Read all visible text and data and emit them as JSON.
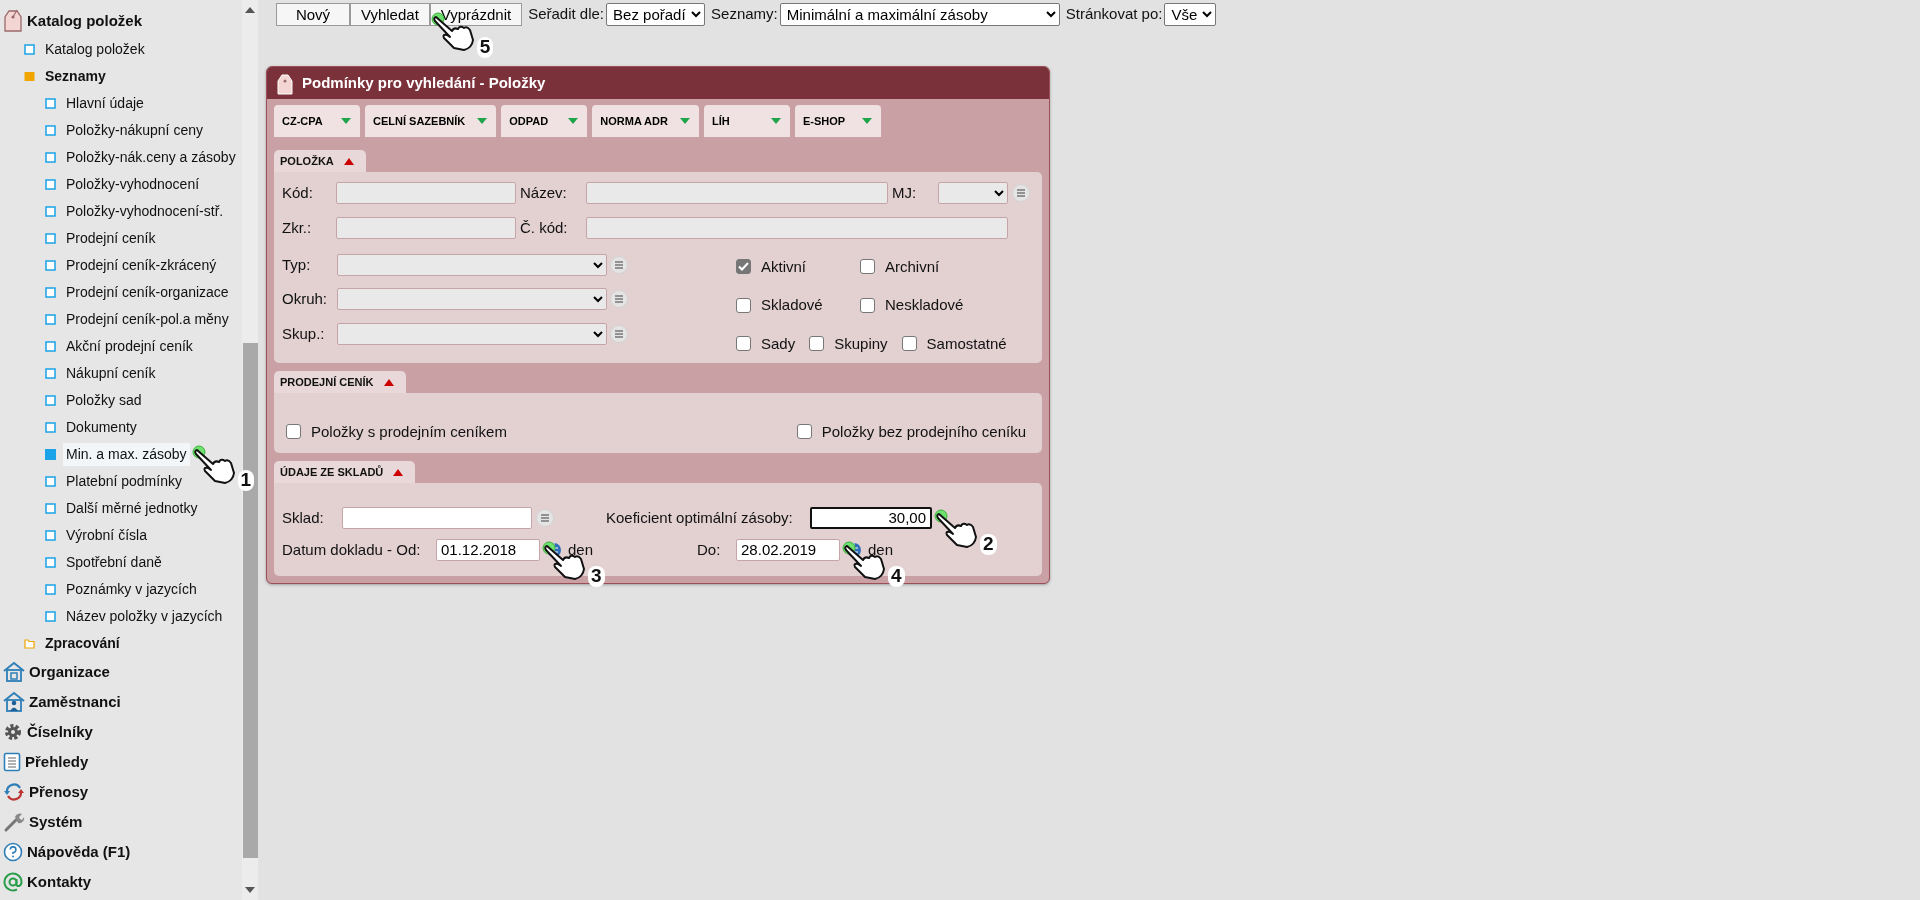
{
  "sidebar": {
    "items": [
      {
        "label": "Katalog položek",
        "kind": "catalog",
        "children": [
          {
            "label": "Katalog položek",
            "kind": "leaf",
            "selected": false
          },
          {
            "label": "Seznamy",
            "kind": "folder",
            "expanded": true,
            "children": [
              {
                "label": "Hlavní údaje",
                "kind": "leaf",
                "selected": false
              },
              {
                "label": "Položky-nákupní ceny",
                "kind": "leaf",
                "selected": false
              },
              {
                "label": "Položky-nák.ceny a zásoby",
                "kind": "leaf",
                "selected": false
              },
              {
                "label": "Položky-vyhodnocení",
                "kind": "leaf",
                "selected": false
              },
              {
                "label": "Položky-vyhodnocení-stř.",
                "kind": "leaf",
                "selected": false
              },
              {
                "label": "Prodejní ceník",
                "kind": "leaf",
                "selected": false
              },
              {
                "label": "Prodejní ceník-zkrácený",
                "kind": "leaf",
                "selected": false
              },
              {
                "label": "Prodejní ceník-organizace",
                "kind": "leaf",
                "selected": false
              },
              {
                "label": "Prodejní ceník-pol.a měny",
                "kind": "leaf",
                "selected": false
              },
              {
                "label": "Akční prodejní ceník",
                "kind": "leaf",
                "selected": false
              },
              {
                "label": "Nákupní ceník",
                "kind": "leaf",
                "selected": false
              },
              {
                "label": "Položky sad",
                "kind": "leaf",
                "selected": false
              },
              {
                "label": "Dokumenty",
                "kind": "leaf",
                "selected": false
              },
              {
                "label": "Min. a max. zásoby",
                "kind": "leaf",
                "selected": true,
                "callout": "1"
              },
              {
                "label": "Platební podmínky",
                "kind": "leaf",
                "selected": false
              },
              {
                "label": "Další měrné jednotky",
                "kind": "leaf",
                "selected": false
              },
              {
                "label": "Výrobní čísla",
                "kind": "leaf",
                "selected": false
              },
              {
                "label": "Spotřební daně",
                "kind": "leaf",
                "selected": false
              },
              {
                "label": "Poznámky v jazycích",
                "kind": "leaf",
                "selected": false
              },
              {
                "label": "Název položky v jazycích",
                "kind": "leaf",
                "selected": false
              }
            ]
          },
          {
            "label": "Zpracování",
            "kind": "folder",
            "expanded": false
          }
        ]
      },
      {
        "label": "Organizace",
        "kind": "organization"
      },
      {
        "label": "Zaměstnanci",
        "kind": "employees"
      },
      {
        "label": "Číselníky",
        "kind": "gear"
      },
      {
        "label": "Přehledy",
        "kind": "list"
      },
      {
        "label": "Přenosy",
        "kind": "transfer"
      },
      {
        "label": "Systém",
        "kind": "wrench"
      },
      {
        "label": "Nápověda (F1)",
        "kind": "help"
      },
      {
        "label": "Kontakty",
        "kind": "contacts"
      }
    ]
  },
  "toolbar": {
    "buttons": [
      {
        "label": "Nový"
      },
      {
        "label": "Vyhledat",
        "callout": "5"
      },
      {
        "label": "Vyprázdnit"
      }
    ],
    "selects": [
      {
        "label": "Seřadit dle:",
        "value": "Bez pořadí"
      },
      {
        "label": "Seznamy:",
        "value": "Minimální a maximální zásoby"
      },
      {
        "label": "Stránkovat po:",
        "value": "Vše"
      }
    ]
  },
  "dialog": {
    "title": "Podmínky pro vyhledání - Položky",
    "tabs": [
      {
        "label": "CZ-CPA"
      },
      {
        "label": "CELNÍ SAZEBNÍK"
      },
      {
        "label": "ODPAD"
      },
      {
        "label": "NORMA ADR"
      },
      {
        "label": "LÍH"
      },
      {
        "label": "E-SHOP"
      }
    ],
    "sections": [
      {
        "kind": "item",
        "title": "POLOŽKA",
        "expanded": true,
        "text_rows": [
          [
            {
              "label": "Kód:",
              "kind": "text"
            },
            {
              "label": "Název:",
              "kind": "text"
            },
            {
              "label": "MJ:",
              "kind": "select",
              "list_button": true
            }
          ],
          [
            {
              "label": "Zkr.:",
              "kind": "text"
            },
            {
              "label": "Č. kód:",
              "kind": "text"
            }
          ]
        ],
        "select_rows": [
          {
            "label": "Typ:",
            "list_button": true
          },
          {
            "label": "Okruh:",
            "list_button": true
          },
          {
            "label": "Skup.:",
            "list_button": true
          }
        ],
        "checkbox_rows": [
          [
            {
              "label": "Aktivní",
              "checked": true
            },
            {
              "label": "Archivní",
              "checked": false
            }
          ],
          [
            {
              "label": "Skladové",
              "checked": false
            },
            {
              "label": "Neskladové",
              "checked": false
            }
          ],
          [
            {
              "label": "Sady",
              "checked": false
            },
            {
              "label": "Skupiny",
              "checked": false
            },
            {
              "label": "Samostatné",
              "checked": false
            }
          ]
        ]
      },
      {
        "kind": "price",
        "title": "PRODEJNÍ CENÍK",
        "expanded": true,
        "checkboxes": [
          {
            "label": "Položky s prodejním ceníkem",
            "checked": false
          },
          {
            "label": "Položky bez prodejního ceníku",
            "checked": false
          }
        ]
      },
      {
        "kind": "stock",
        "title": "ÚDAJE ZE SKLADŮ",
        "expanded": true,
        "store": {
          "label": "Sklad:",
          "list_button": true
        },
        "coefficient": {
          "label": "Koeficient optimální zásoby:",
          "value": "30,00",
          "focused": true,
          "callout": "2"
        },
        "date_from": {
          "label": "Datum dokladu - Od:",
          "value": "01.12.2018",
          "unit": "den",
          "callout": "3"
        },
        "date_to": {
          "label": "Do:",
          "value": "28.02.2019",
          "unit": "den",
          "callout": "4"
        }
      }
    ]
  }
}
